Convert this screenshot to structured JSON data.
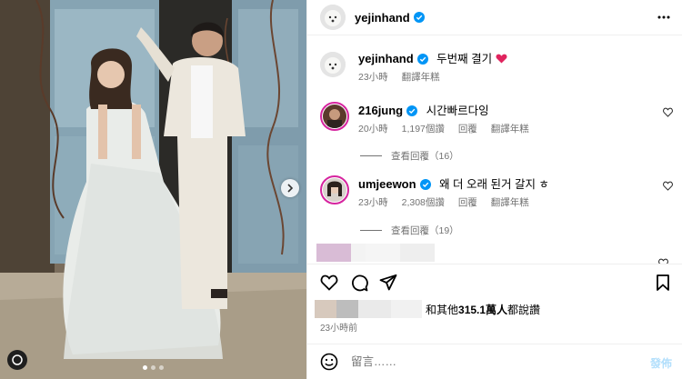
{
  "post": {
    "author": "yejinhand",
    "menu_icon": "more-horizontal-icon"
  },
  "caption": {
    "author": "yejinhand",
    "text": "두번째 결기",
    "time": "23小時",
    "translate": "翻譯年糕"
  },
  "comments": [
    {
      "author": "216jung",
      "text": "시간빠르다잉",
      "time": "20小時",
      "likes": "1,197個讚",
      "reply": "回覆",
      "translate": "翻譯年糕",
      "view_replies": "查看回覆（16）"
    },
    {
      "author": "umjeewon",
      "text": "왜 더 오래 된거 갈지 ㅎ",
      "time": "23小時",
      "likes": "2,308個讚",
      "reply": "回覆",
      "translate": "翻譯年糕",
      "view_replies": "查看回覆（19）"
    }
  ],
  "liked_by": {
    "text_prefix": "和其他",
    "count": "315.1萬人",
    "text_suffix": "都說讚"
  },
  "posted_time": "23小時前",
  "composer": {
    "placeholder": "留言……",
    "post_label": "發佈"
  },
  "colors": {
    "verified": "#0095f6",
    "post_button_disabled": "#b2dffc",
    "muted_text": "#737373",
    "divider": "#efefef"
  }
}
